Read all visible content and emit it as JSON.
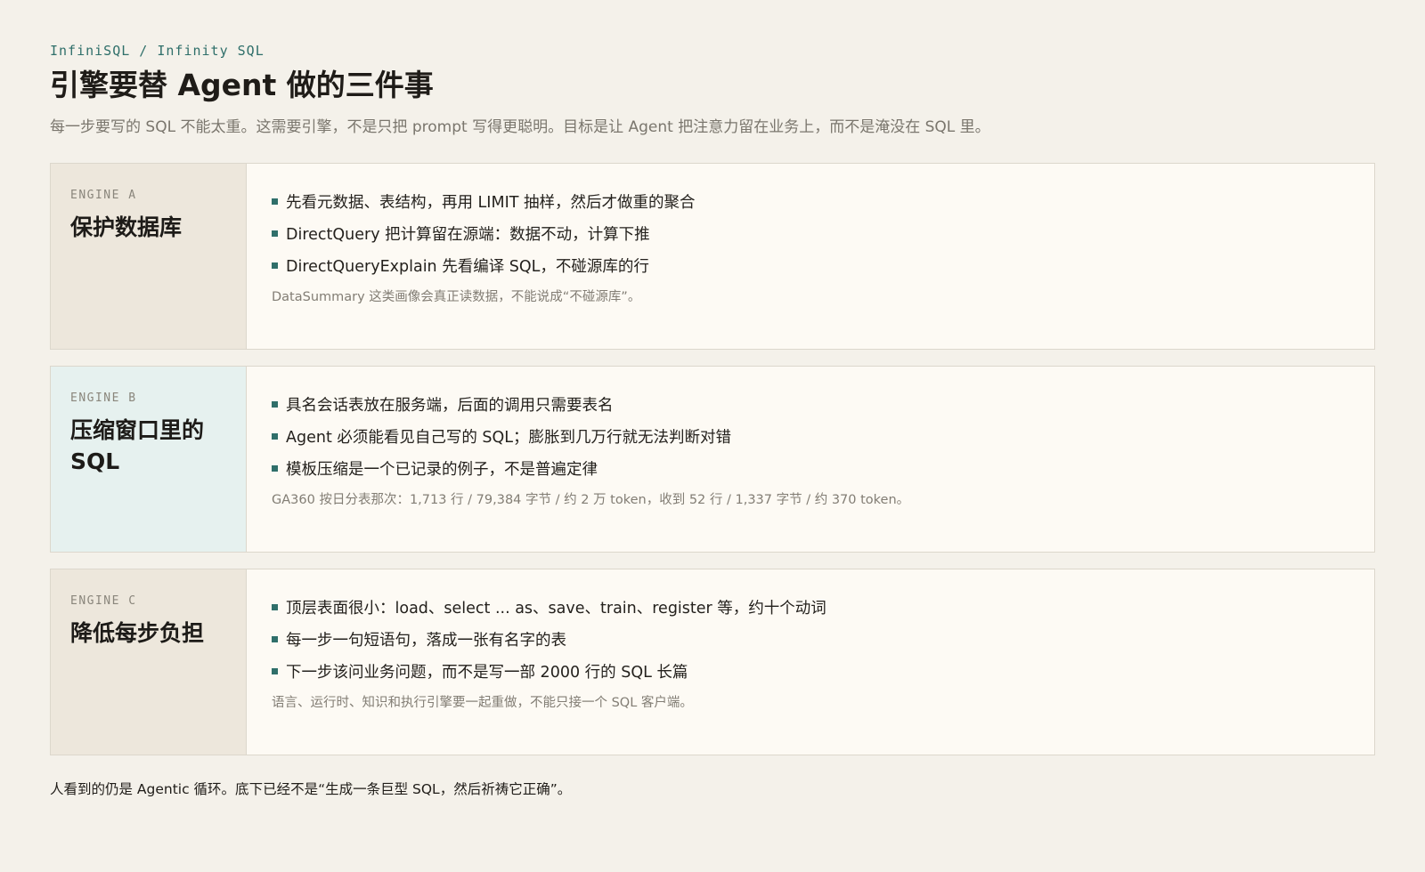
{
  "header": {
    "kicker": "InfiniSQL / Infinity SQL",
    "title": "引擎要替 Agent 做的三件事",
    "subtitle": "每一步要写的 SQL 不能太重。这需要引擎，不是只把 prompt 写得更聪明。目标是让 Agent 把注意力留在业务上，而不是淹没在 SQL 里。"
  },
  "cards": [
    {
      "label": "ENGINE A",
      "name": "保护数据库",
      "bullets": [
        "先看元数据、表结构，再用 LIMIT 抽样，然后才做重的聚合",
        "DirectQuery 把计算留在源端：数据不动，计算下推",
        "DirectQueryExplain 先看编译 SQL，不碰源库的行"
      ],
      "note": "DataSummary 这类画像会真正读数据，不能说成“不碰源库”。"
    },
    {
      "label": "ENGINE B",
      "name": "压缩窗口里的 SQL",
      "bullets": [
        "具名会话表放在服务端，后面的调用只需要表名",
        "Agent 必须能看见自己写的 SQL；膨胀到几万行就无法判断对错",
        "模板压缩是一个已记录的例子，不是普遍定律"
      ],
      "note": "GA360 按日分表那次：1,713 行 / 79,384 字节 / 约 2 万 token，收到 52 行 / 1,337 字节 / 约 370 token。"
    },
    {
      "label": "ENGINE C",
      "name": "降低每步负担",
      "bullets": [
        "顶层表面很小：load、select ... as、save、train、register 等，约十个动词",
        "每一步一句短语句，落成一张有名字的表",
        "下一步该问业务问题，而不是写一部 2000 行的 SQL 长篇"
      ],
      "note": "语言、运行时、知识和执行引擎要一起重做，不能只接一个 SQL 客户端。"
    }
  ],
  "footer": {
    "text": "人看到的仍是 Agentic 循环。底下已经不是“生成一条巨型 SQL，然后祈祷它正确”。"
  },
  "colors": {
    "accent": "#2f6f6a",
    "background": "#f4f1ea",
    "card_left_beige": "#ede7dc",
    "card_left_teal": "#e6f1ef"
  }
}
